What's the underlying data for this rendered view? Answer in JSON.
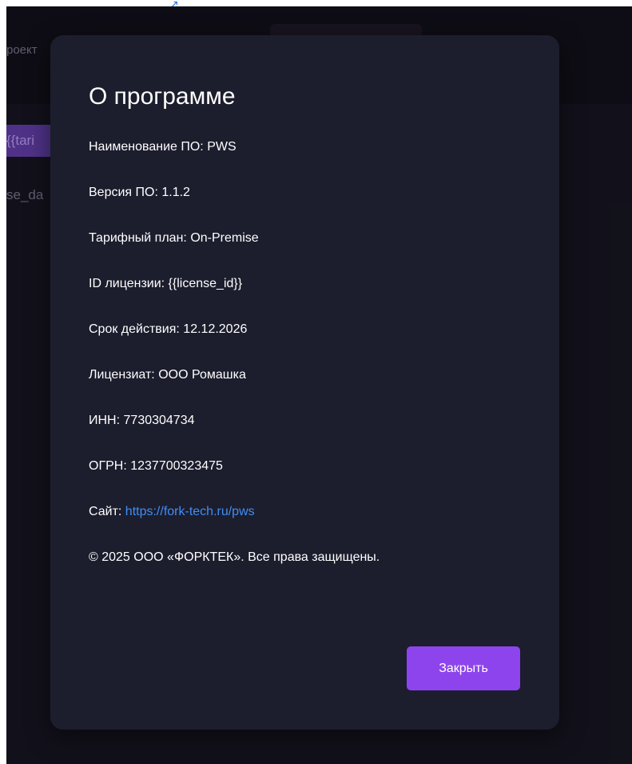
{
  "top_fragment": "↗",
  "background": {
    "project_label": "роект",
    "tariff_chip": "{{tari",
    "date_label": "se_da"
  },
  "modal": {
    "title": "О программе",
    "rows": [
      {
        "label": "Наименование ПО:",
        "value": "PWS"
      },
      {
        "label": "Версия ПО:",
        "value": "1.1.2"
      },
      {
        "label": "Тарифный план:",
        "value": "On-Premise"
      },
      {
        "label": "ID лицензии:",
        "value": "{{license_id}}"
      },
      {
        "label": "Срок действия:",
        "value": "12.12.2026"
      },
      {
        "label": "Лицензиат:",
        "value": "ООО Ромашка"
      },
      {
        "label": "ИНН:",
        "value": "7730304734"
      },
      {
        "label": "ОГРН:",
        "value": "1237700323475"
      }
    ],
    "site": {
      "label": "Сайт:",
      "url": "https://fork-tech.ru/pws"
    },
    "copyright": "© 2025 ООО «ФОРКТЕК». Все права защищены.",
    "close_label": "Закрыть"
  },
  "colors": {
    "background": "#15141f",
    "modal": "#1c1d2d",
    "accent": "#8e44ec",
    "link": "#3f8ef5"
  }
}
